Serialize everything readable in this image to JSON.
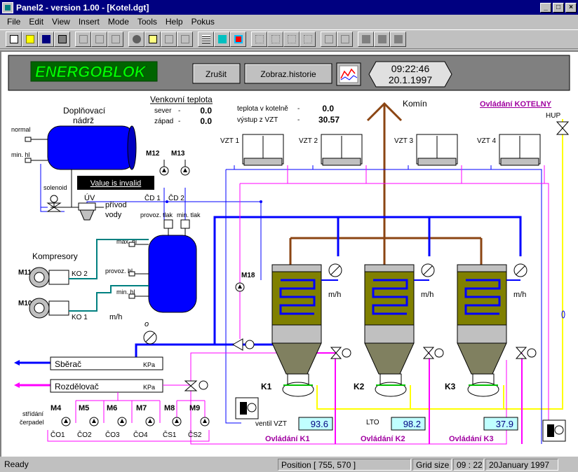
{
  "window": {
    "title": "Panel2 - version 1.00 - [Kotel.dgt]"
  },
  "menu": [
    "File",
    "Edit",
    "View",
    "Insert",
    "Mode",
    "Tools",
    "Help",
    "Pokus"
  ],
  "header": {
    "logo": "ENERGOBLOK",
    "cancel_button": "Zrušit",
    "history_button": "Zobraz.historie",
    "time": "09:22:46",
    "date": "20.1.1997"
  },
  "outdoor": {
    "title": "Venkovní teplota",
    "north_label": "sever",
    "north_value": "0.0",
    "west_label": "západ",
    "west_value": "0.0"
  },
  "boiler_temp": {
    "room_label": "teplota v kotelně",
    "room_value": "0.0",
    "vzt_label": "výstup z VZT",
    "vzt_value": "30.57"
  },
  "labels": {
    "chimney": "Komín",
    "control_boilers": "Ovládání KOTELNY",
    "hup": "HUP",
    "tank_title_1": "Doplňovací",
    "tank_title_2": "nádrž",
    "normal": "normal",
    "min_level": "min. hl",
    "solenoid": "solenoid",
    "uv": "ÚV",
    "water_inlet_1": "přívod",
    "water_inlet_2": "vody",
    "invalid": "Value is invalid",
    "m12": "M12",
    "m13": "M13",
    "cd1": "ČD 1",
    "cd2": "ČD 2",
    "oper_pressure": "provoz. tlak",
    "min_pressure": "min. tlak",
    "compressors": "Kompresory",
    "m11": "M11",
    "m10": "M10",
    "ko2": "KO 2",
    "ko1": "KO 1",
    "max_level": "max. hl",
    "oper_level": "provoz. hl",
    "min_level2": "min. hl",
    "mh": "m/h",
    "m18": "M18",
    "collector": "Sběrač",
    "distributor": "Rozdělovač",
    "kpa": "KPa",
    "m4": "M4",
    "m5": "M5",
    "m6": "M6",
    "m7": "M7",
    "m8": "M8",
    "m9": "M9",
    "alternate_1": "střídání",
    "alternate_2": "čerpadel",
    "co1": "ČO1",
    "co2": "ČO2",
    "co3": "ČO3",
    "co4": "ČO4",
    "cs1": "ČS1",
    "cs2": "ČS2",
    "vzt1": "VZT 1",
    "vzt2": "VZT 2",
    "vzt3": "VZT 3",
    "vzt4": "VZT 4",
    "k1": "K1",
    "k2": "K2",
    "k3": "K3",
    "ventil_vzt": "ventil VZT",
    "lto": "LTO",
    "ctrl_k1": "Ovládání K1",
    "ctrl_k2": "Ovládání K2",
    "ctrl_k3": "Ovládání K3"
  },
  "readouts": {
    "ventil_vzt": "93.6",
    "lto": "98.2",
    "k3": "37.9"
  },
  "status": {
    "ready": "Ready",
    "position": "Position [ 755, 570 ]",
    "grid": "Grid size",
    "time": "09 : 22",
    "date": "20January 1997"
  },
  "colors": {
    "blue": "#0000ff",
    "navy": "#000080",
    "magenta": "#ff00ff",
    "yellow": "#ffff00",
    "olive": "#808000",
    "brown": "#8b4513",
    "teal": "#008080",
    "cyan_readout": "#c0ffff"
  }
}
